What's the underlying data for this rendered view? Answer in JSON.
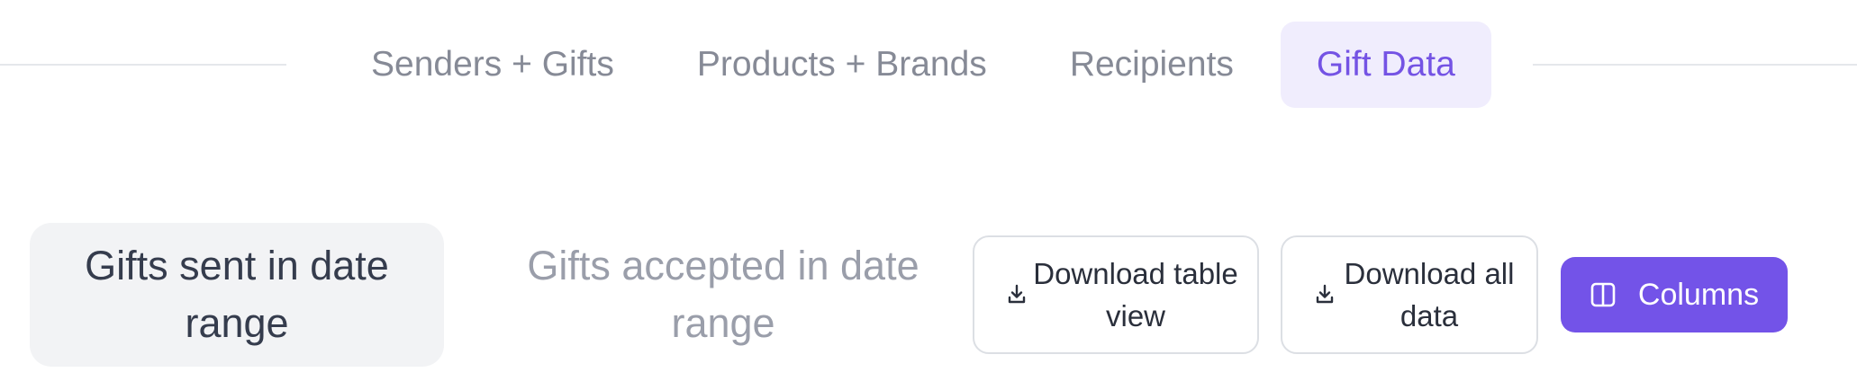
{
  "tabs": [
    {
      "label": "Senders + Gifts",
      "active": false
    },
    {
      "label": "Products + Brands",
      "active": false
    },
    {
      "label": "Recipients",
      "active": false
    },
    {
      "label": "Gift Data",
      "active": true
    }
  ],
  "filters": {
    "sent_label": "Gifts sent in date range",
    "accepted_label": "Gifts accepted in date range"
  },
  "actions": {
    "download_table_label": "Download table view",
    "download_all_label": "Download all data",
    "columns_label": "Columns"
  },
  "icons": {
    "download": "download-icon",
    "columns": "columns-icon"
  },
  "colors": {
    "accent": "#7353e8",
    "active_tab_bg": "#f0edfd",
    "active_tab_text": "#7453e4",
    "inactive_text": "#868a96"
  }
}
